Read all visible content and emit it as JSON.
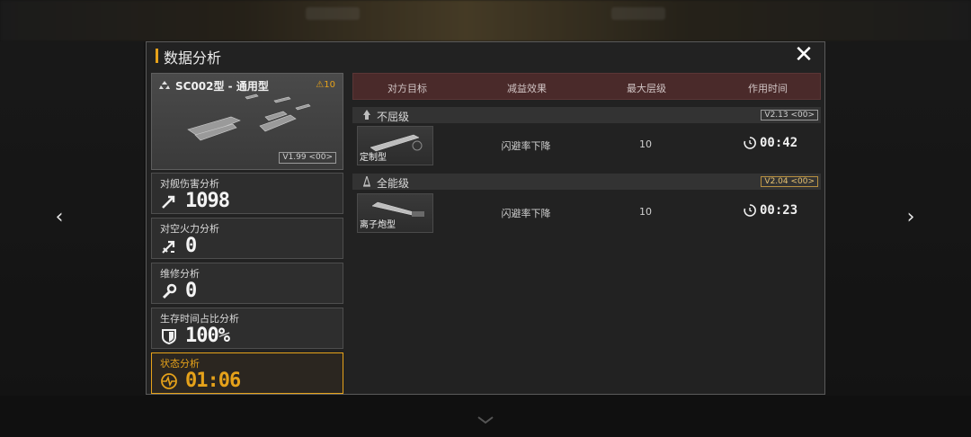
{
  "background": {
    "accent": "#e6a21a"
  },
  "nav": {
    "prev_glyph": "‹",
    "next_glyph": "›"
  },
  "modal": {
    "title": "数据分析",
    "close_glyph": "✕"
  },
  "ship": {
    "name": "SC002型 - 通用型",
    "level": "⚠10",
    "version": "V1.99 <00>"
  },
  "stats": [
    {
      "label": "对舰伤害分析",
      "value": "1098",
      "icon": "anti-ship-icon"
    },
    {
      "label": "对空火力分析",
      "value": "0",
      "icon": "anti-air-icon"
    },
    {
      "label": "维修分析",
      "value": "0",
      "icon": "wrench-icon"
    },
    {
      "label": "生存时间占比分析",
      "value": "100%",
      "icon": "shield-icon"
    },
    {
      "label": "状态分析",
      "value": "01:06",
      "icon": "pulse-icon",
      "active": true
    }
  ],
  "table": {
    "headers": [
      "对方目标",
      "减益效果",
      "最大层级",
      "作用时间"
    ],
    "groups": [
      {
        "name": "不屈级",
        "version": "V2.13 <00>",
        "rows": [
          {
            "target": "定制型",
            "effect": "闪避率下降",
            "max_level": "10",
            "duration": "00:42"
          }
        ]
      },
      {
        "name": "全能级",
        "version": "V2.04 <00>",
        "rows": [
          {
            "target": "离子炮型",
            "effect": "闪避率下降",
            "max_level": "10",
            "duration": "00:23"
          }
        ]
      }
    ]
  }
}
